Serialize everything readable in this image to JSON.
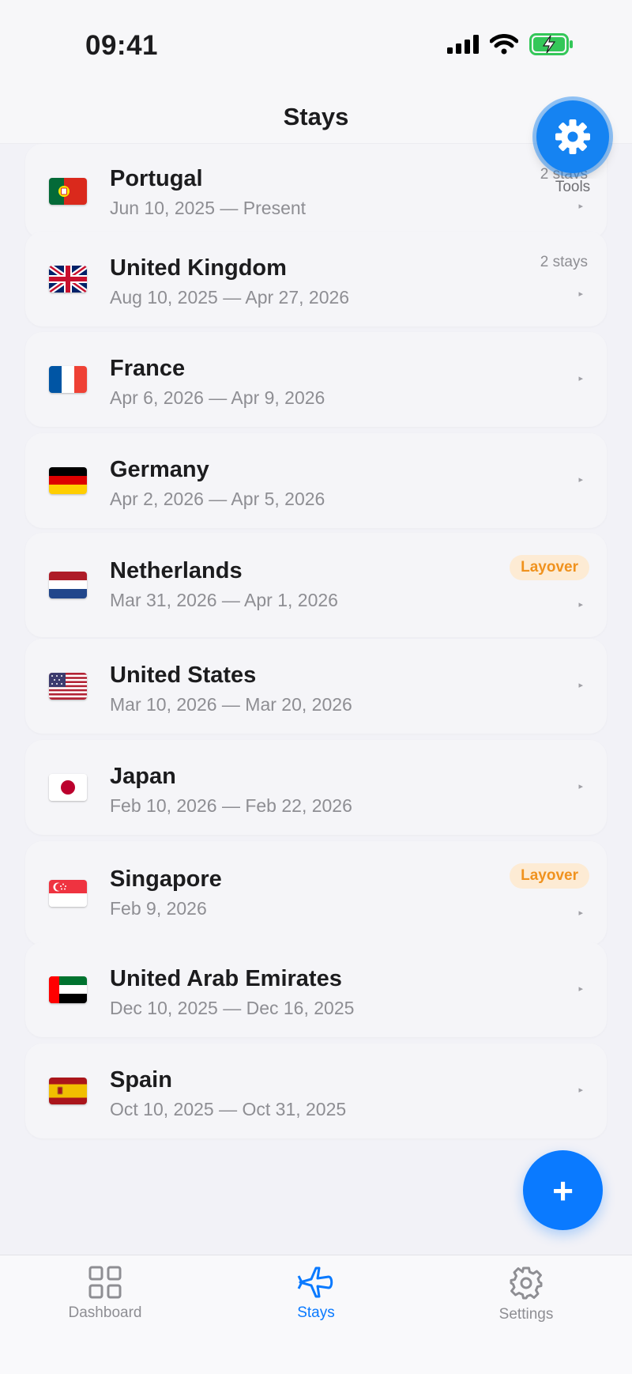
{
  "status_bar": {
    "time": "09:41"
  },
  "nav": {
    "title": "Stays"
  },
  "tools_button": {
    "label": "Tools"
  },
  "stays": [
    {
      "country": "Portugal",
      "flag": "portugal",
      "dates": "Jun 10, 2025 — Present",
      "meta": "2 stays"
    },
    {
      "country": "United Kingdom",
      "flag": "united-kingdom",
      "dates": "Aug 10, 2025 — Apr 27, 2026",
      "meta": "2 stays"
    },
    {
      "country": "France",
      "flag": "france",
      "dates": "Apr 6, 2026 — Apr 9, 2026"
    },
    {
      "country": "Germany",
      "flag": "germany",
      "dates": "Apr 2, 2026 — Apr 5, 2026"
    },
    {
      "country": "Netherlands",
      "flag": "netherlands",
      "dates": "Mar 31, 2026 — Apr 1, 2026",
      "badge": "Layover"
    },
    {
      "country": "United States",
      "flag": "united-states",
      "dates": "Mar 10, 2026 — Mar 20, 2026"
    },
    {
      "country": "Japan",
      "flag": "japan",
      "dates": "Feb 10, 2026 — Feb 22, 2026"
    },
    {
      "country": "Singapore",
      "flag": "singapore",
      "dates": "Feb 9, 2026",
      "badge": "Layover"
    },
    {
      "country": "United Arab Emirates",
      "flag": "united-arab-emirates",
      "dates": "Dec 10, 2025 — Dec 16, 2025"
    },
    {
      "country": "Spain",
      "flag": "spain",
      "dates": "Oct 10, 2025 — Oct 31, 2025"
    }
  ],
  "add_button": {
    "label": "+"
  },
  "tabs": [
    {
      "label": "Dashboard",
      "icon": "grid-icon"
    },
    {
      "label": "Stays",
      "icon": "airplane-icon",
      "active": true
    },
    {
      "label": "Settings",
      "icon": "gear-icon"
    }
  ],
  "colors": {
    "accent": "#0a7aff",
    "layover_badge_bg": "#fdebd4",
    "layover_badge_text": "#f0921e"
  }
}
